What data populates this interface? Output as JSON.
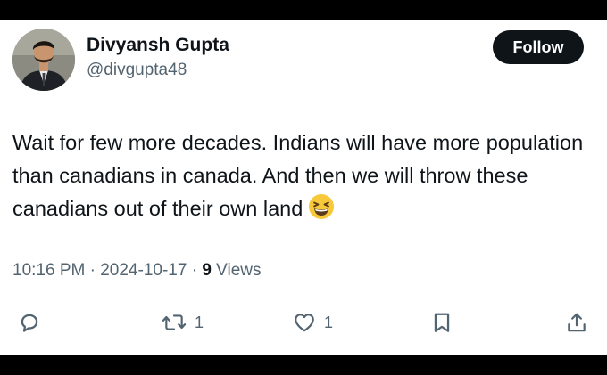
{
  "author": {
    "name": "Divyansh Gupta",
    "handle": "@divgupta48",
    "avatar_icon": "profile-photo"
  },
  "follow_button": {
    "label": "Follow"
  },
  "tweet": {
    "text": "Wait for few more decades. Indians will have more population than canadians in canada. And then we will throw these canadians out of their own land",
    "emoji": "grinning-squinting-face-emoji"
  },
  "meta": {
    "time": "10:16 PM",
    "date": "2024-10-17",
    "separator": "·",
    "views_count": "9",
    "views_label": "Views"
  },
  "actions": {
    "reply": {
      "icon": "reply-icon"
    },
    "retweet": {
      "icon": "retweet-icon",
      "count": "1"
    },
    "like": {
      "icon": "like-icon",
      "count": "1"
    },
    "bookmark": {
      "icon": "bookmark-icon"
    },
    "share": {
      "icon": "share-icon"
    }
  },
  "colors": {
    "text_primary": "#0f1419",
    "text_secondary": "#536471",
    "button_bg": "#0f1419",
    "background": "#ffffff"
  }
}
